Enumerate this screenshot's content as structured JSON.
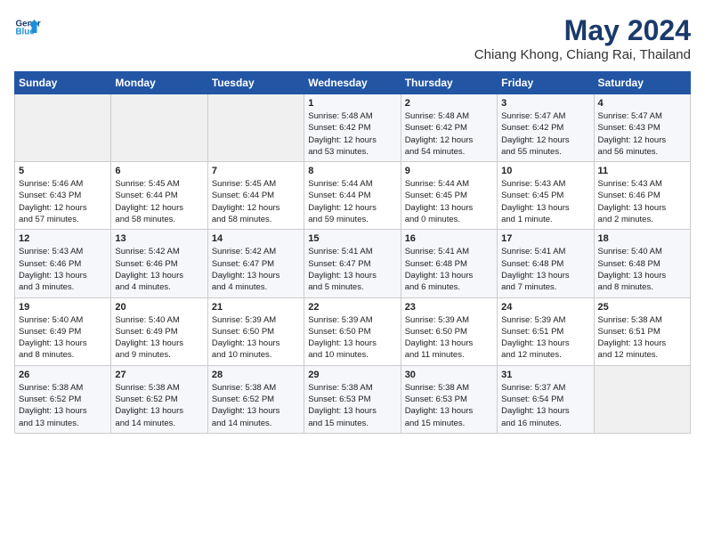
{
  "logo": {
    "line1": "General",
    "line2": "Blue"
  },
  "title": "May 2024",
  "subtitle": "Chiang Khong, Chiang Rai, Thailand",
  "days_of_week": [
    "Sunday",
    "Monday",
    "Tuesday",
    "Wednesday",
    "Thursday",
    "Friday",
    "Saturday"
  ],
  "weeks": [
    [
      {
        "day": "",
        "info": ""
      },
      {
        "day": "",
        "info": ""
      },
      {
        "day": "",
        "info": ""
      },
      {
        "day": "1",
        "info": "Sunrise: 5:48 AM\nSunset: 6:42 PM\nDaylight: 12 hours\nand 53 minutes."
      },
      {
        "day": "2",
        "info": "Sunrise: 5:48 AM\nSunset: 6:42 PM\nDaylight: 12 hours\nand 54 minutes."
      },
      {
        "day": "3",
        "info": "Sunrise: 5:47 AM\nSunset: 6:42 PM\nDaylight: 12 hours\nand 55 minutes."
      },
      {
        "day": "4",
        "info": "Sunrise: 5:47 AM\nSunset: 6:43 PM\nDaylight: 12 hours\nand 56 minutes."
      }
    ],
    [
      {
        "day": "5",
        "info": "Sunrise: 5:46 AM\nSunset: 6:43 PM\nDaylight: 12 hours\nand 57 minutes."
      },
      {
        "day": "6",
        "info": "Sunrise: 5:45 AM\nSunset: 6:44 PM\nDaylight: 12 hours\nand 58 minutes."
      },
      {
        "day": "7",
        "info": "Sunrise: 5:45 AM\nSunset: 6:44 PM\nDaylight: 12 hours\nand 58 minutes."
      },
      {
        "day": "8",
        "info": "Sunrise: 5:44 AM\nSunset: 6:44 PM\nDaylight: 12 hours\nand 59 minutes."
      },
      {
        "day": "9",
        "info": "Sunrise: 5:44 AM\nSunset: 6:45 PM\nDaylight: 13 hours\nand 0 minutes."
      },
      {
        "day": "10",
        "info": "Sunrise: 5:43 AM\nSunset: 6:45 PM\nDaylight: 13 hours\nand 1 minute."
      },
      {
        "day": "11",
        "info": "Sunrise: 5:43 AM\nSunset: 6:46 PM\nDaylight: 13 hours\nand 2 minutes."
      }
    ],
    [
      {
        "day": "12",
        "info": "Sunrise: 5:43 AM\nSunset: 6:46 PM\nDaylight: 13 hours\nand 3 minutes."
      },
      {
        "day": "13",
        "info": "Sunrise: 5:42 AM\nSunset: 6:46 PM\nDaylight: 13 hours\nand 4 minutes."
      },
      {
        "day": "14",
        "info": "Sunrise: 5:42 AM\nSunset: 6:47 PM\nDaylight: 13 hours\nand 4 minutes."
      },
      {
        "day": "15",
        "info": "Sunrise: 5:41 AM\nSunset: 6:47 PM\nDaylight: 13 hours\nand 5 minutes."
      },
      {
        "day": "16",
        "info": "Sunrise: 5:41 AM\nSunset: 6:48 PM\nDaylight: 13 hours\nand 6 minutes."
      },
      {
        "day": "17",
        "info": "Sunrise: 5:41 AM\nSunset: 6:48 PM\nDaylight: 13 hours\nand 7 minutes."
      },
      {
        "day": "18",
        "info": "Sunrise: 5:40 AM\nSunset: 6:48 PM\nDaylight: 13 hours\nand 8 minutes."
      }
    ],
    [
      {
        "day": "19",
        "info": "Sunrise: 5:40 AM\nSunset: 6:49 PM\nDaylight: 13 hours\nand 8 minutes."
      },
      {
        "day": "20",
        "info": "Sunrise: 5:40 AM\nSunset: 6:49 PM\nDaylight: 13 hours\nand 9 minutes."
      },
      {
        "day": "21",
        "info": "Sunrise: 5:39 AM\nSunset: 6:50 PM\nDaylight: 13 hours\nand 10 minutes."
      },
      {
        "day": "22",
        "info": "Sunrise: 5:39 AM\nSunset: 6:50 PM\nDaylight: 13 hours\nand 10 minutes."
      },
      {
        "day": "23",
        "info": "Sunrise: 5:39 AM\nSunset: 6:50 PM\nDaylight: 13 hours\nand 11 minutes."
      },
      {
        "day": "24",
        "info": "Sunrise: 5:39 AM\nSunset: 6:51 PM\nDaylight: 13 hours\nand 12 minutes."
      },
      {
        "day": "25",
        "info": "Sunrise: 5:38 AM\nSunset: 6:51 PM\nDaylight: 13 hours\nand 12 minutes."
      }
    ],
    [
      {
        "day": "26",
        "info": "Sunrise: 5:38 AM\nSunset: 6:52 PM\nDaylight: 13 hours\nand 13 minutes."
      },
      {
        "day": "27",
        "info": "Sunrise: 5:38 AM\nSunset: 6:52 PM\nDaylight: 13 hours\nand 14 minutes."
      },
      {
        "day": "28",
        "info": "Sunrise: 5:38 AM\nSunset: 6:52 PM\nDaylight: 13 hours\nand 14 minutes."
      },
      {
        "day": "29",
        "info": "Sunrise: 5:38 AM\nSunset: 6:53 PM\nDaylight: 13 hours\nand 15 minutes."
      },
      {
        "day": "30",
        "info": "Sunrise: 5:38 AM\nSunset: 6:53 PM\nDaylight: 13 hours\nand 15 minutes."
      },
      {
        "day": "31",
        "info": "Sunrise: 5:37 AM\nSunset: 6:54 PM\nDaylight: 13 hours\nand 16 minutes."
      },
      {
        "day": "",
        "info": ""
      }
    ]
  ]
}
